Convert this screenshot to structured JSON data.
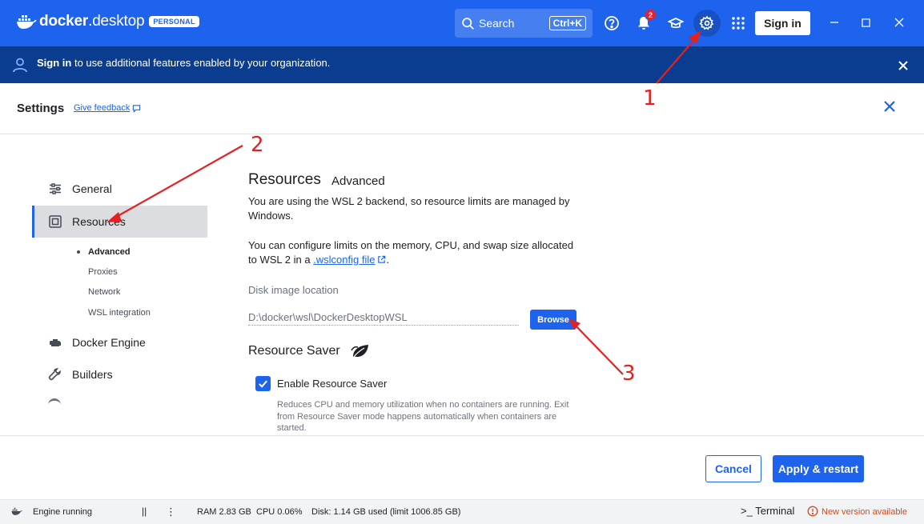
{
  "titlebar": {
    "app_name_bold": "docker",
    "app_name_rest": ".desktop",
    "edition_badge": "PERSONAL",
    "search_label": "Search",
    "search_shortcut": "Ctrl+K",
    "notifications_count": "2",
    "sign_in_label": "Sign in",
    "brand_color": "#1d63ed"
  },
  "banner": {
    "bold_text": "Sign in",
    "rest_text": " to use additional features enabled by your organization."
  },
  "settings": {
    "title": "Settings",
    "feedback_label": "Give feedback"
  },
  "sidebar": {
    "items": [
      {
        "label": "General",
        "icon": "sliders-icon"
      },
      {
        "label": "Resources",
        "icon": "resources-icon",
        "selected": true
      },
      {
        "label": "Docker Engine",
        "icon": "engine-icon"
      },
      {
        "label": "Builders",
        "icon": "wrench-icon"
      }
    ],
    "subitems": [
      {
        "label": "Advanced",
        "active": true
      },
      {
        "label": "Proxies"
      },
      {
        "label": "Network"
      },
      {
        "label": "WSL integration"
      }
    ]
  },
  "main": {
    "heading": "Resources",
    "subheading": "Advanced",
    "para1": "You are using the WSL 2 backend, so resource limits are managed by Windows.",
    "para2_prefix": "You can configure limits on the memory, CPU, and swap size allocated to WSL 2 in a ",
    "para2_link": ".wslconfig file",
    "para2_suffix": ".",
    "disk_label": "Disk image location",
    "disk_value": "D:\\docker\\wsl\\DockerDesktopWSL",
    "browse_label": "Browse",
    "saver_heading": "Resource Saver",
    "saver_checkbox_label": "Enable Resource Saver",
    "saver_checked": true,
    "saver_help": "Reduces CPU and memory utilization when no containers are running. Exit from Resource Saver mode happens automatically when containers are started."
  },
  "actions": {
    "cancel_label": "Cancel",
    "apply_label": "Apply & restart"
  },
  "statusbar": {
    "engine_status": "Engine running",
    "pause_symbol": "||",
    "more_symbol": "⋮",
    "ram": "RAM 2.83 GB",
    "cpu": "CPU 0.06%",
    "disk": "Disk: 1.14 GB used (limit 1006.85 GB)",
    "terminal_label": "Terminal",
    "update_notice": "New version available"
  },
  "annotations": {
    "step1": "1",
    "step2": "2",
    "step3": "3",
    "color": "#e52020"
  }
}
